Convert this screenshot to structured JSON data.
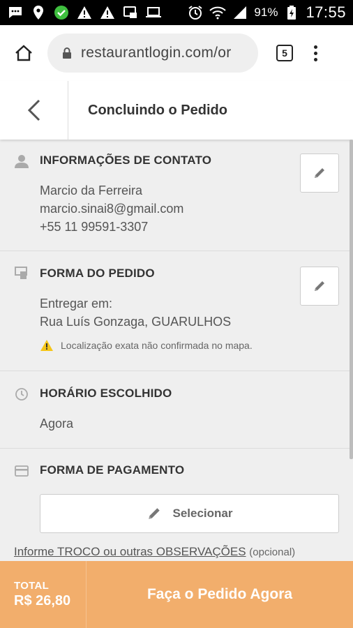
{
  "status_bar": {
    "icons": [
      "message-icon",
      "location-icon",
      "check-badge-icon",
      "warning-icon",
      "warning-icon",
      "screenshot-icon",
      "laptop-icon",
      "alarm-icon",
      "wifi-icon",
      "signal-icon"
    ],
    "battery": "91%",
    "time": "17:55"
  },
  "browser": {
    "url": "restaurantlogin.com/or",
    "tab_count": "5"
  },
  "header": {
    "title": "Concluindo o Pedido"
  },
  "contact": {
    "title": "INFORMAÇÕES DE CONTATO",
    "name": "Marcio da Ferreira",
    "email": "marcio.sinai8@gmail.com",
    "phone": "+55 11 99591-3307"
  },
  "order_form": {
    "title": "FORMA DO PEDIDO",
    "deliver_label": "Entregar em:",
    "address": "Rua Luís Gonzaga, GUARULHOS",
    "warning": "Localização exata não confirmada no mapa."
  },
  "schedule": {
    "title": "HORÁRIO ESCOLHIDO",
    "value": "Agora"
  },
  "payment": {
    "title": "FORMA DE PAGAMENTO",
    "select_label": "Selecionar"
  },
  "observations": {
    "link": "Informe TROCO ou outras OBSERVAÇÕES",
    "optional": "(opcional)"
  },
  "footer": {
    "total_label": "TOTAL",
    "total_value": "R$ 26,80",
    "cta": "Faça o Pedido Agora"
  },
  "colors": {
    "accent": "#f2ae6c",
    "warning": "#f5c518"
  }
}
